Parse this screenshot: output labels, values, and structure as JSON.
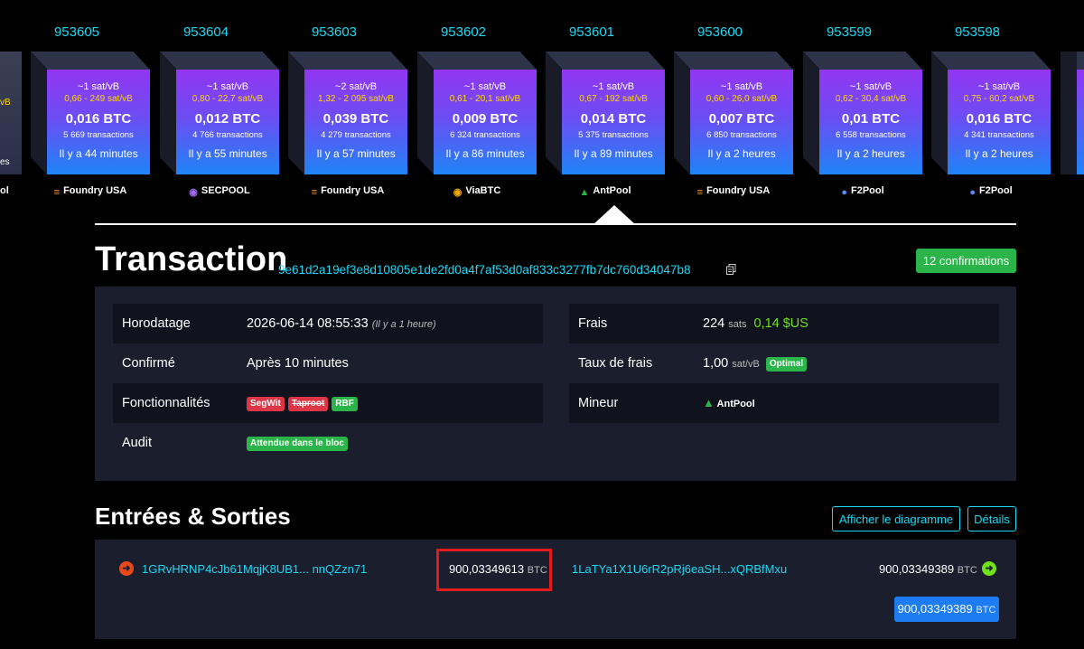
{
  "blocks": [
    {
      "height": "953605",
      "fee": "~1 sat/vB",
      "range": "0,66 - 249 sat/vB",
      "size": "0,016 BTC",
      "txs": "5 669 transactions",
      "time": "Il y a 44 minutes",
      "pool": "Foundry USA",
      "pool_icon": "foundry-icon"
    },
    {
      "height": "953604",
      "fee": "~1 sat/vB",
      "range": "0,80 - 22,7 sat/vB",
      "size": "0,012 BTC",
      "txs": "4 766 transactions",
      "time": "Il y a 55 minutes",
      "pool": "SECPOOL",
      "pool_icon": "secpool-icon"
    },
    {
      "height": "953603",
      "fee": "~2 sat/vB",
      "range": "1,32 - 2 095 sat/vB",
      "size": "0,039 BTC",
      "txs": "4 279 transactions",
      "time": "Il y a 57 minutes",
      "pool": "Foundry USA",
      "pool_icon": "foundry-icon"
    },
    {
      "height": "953602",
      "fee": "~1 sat/vB",
      "range": "0,61 - 20,1 sat/vB",
      "size": "0,009 BTC",
      "txs": "6 324 transactions",
      "time": "Il y a 86 minutes",
      "pool": "ViaBTC",
      "pool_icon": "viabtc-icon"
    },
    {
      "height": "953601",
      "fee": "~1 sat/vB",
      "range": "0,67 - 192 sat/vB",
      "size": "0,014 BTC",
      "txs": "5 375 transactions",
      "time": "Il y a 89 minutes",
      "pool": "AntPool",
      "pool_icon": "antpool-icon"
    },
    {
      "height": "953600",
      "fee": "~1 sat/vB",
      "range": "0,60 - 26,0 sat/vB",
      "size": "0,007 BTC",
      "txs": "6 850 transactions",
      "time": "Il y a 2 heures",
      "pool": "Foundry USA",
      "pool_icon": "foundry-icon"
    },
    {
      "height": "953599",
      "fee": "~1 sat/vB",
      "range": "0,62 - 30,4 sat/vB",
      "size": "0,01 BTC",
      "txs": "6 558 transactions",
      "time": "Il y a 2 heures",
      "pool": "F2Pool",
      "pool_icon": "f2pool-icon"
    },
    {
      "height": "953598",
      "fee": "~1 sat/vB",
      "range": "0,75 - 60,2 sat/vB",
      "size": "0,016 BTC",
      "txs": "4 341 transactions",
      "time": "Il y a 2 heures",
      "pool": "F2Pool",
      "pool_icon": "f2pool-icon"
    }
  ],
  "edge_left": {
    "range_fragment": "vB",
    "txs_fragment": "es",
    "pool_fragment": "ol"
  },
  "transaction": {
    "title": "Transaction",
    "txid": "9e61d2a19ef3e8d10805e1de2fd0a4f7af53d0af833c3277fb7dc760d34047b8",
    "confirmations": "12 confirmations",
    "left": [
      {
        "label": "Horodatage",
        "value": "2026-06-14 08:55:33",
        "note": "(Il y a 1 heure)"
      },
      {
        "label": "Confirmé",
        "value": "Après 10 minutes"
      },
      {
        "label": "Fonctionnalités",
        "tags": [
          "SegWit",
          "Taproot",
          "RBF"
        ]
      },
      {
        "label": "Audit",
        "tag": "Attendue dans le bloc"
      }
    ],
    "right": [
      {
        "label": "Frais",
        "value": "224",
        "unit": "sats",
        "usd": "0,14 $US"
      },
      {
        "label": "Taux de frais",
        "value": "1,00",
        "unit": "sat/vB",
        "tag": "Optimal"
      },
      {
        "label": "Mineur",
        "value": "AntPool"
      }
    ]
  },
  "io": {
    "title": "Entrées & Sorties",
    "diagram_button": "Afficher le diagramme",
    "details_button": "Détails",
    "input_address": "1GRvHRNP4cJb61MqjK8UB1... nnQZzn71",
    "input_amount": "900,03349613",
    "output_address": "1LaTYa1X1U6rR2pRj6eaSH...xQRBfMxu",
    "output_amount": "900,03349389",
    "total_amount": "900,03349389",
    "unit": "BTC"
  },
  "colors": {
    "accent_cyan": "#1bd8f4",
    "confirm_green": "#2bb44a",
    "highlight_red": "#e01b1b",
    "total_blue": "#1d7cf2"
  }
}
